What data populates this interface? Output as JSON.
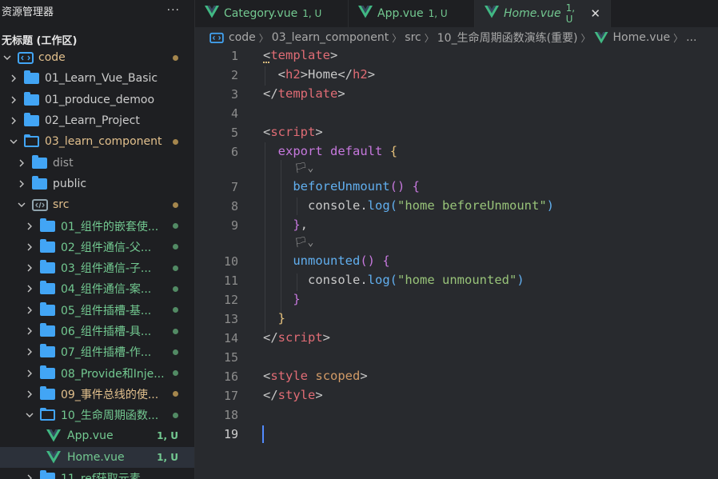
{
  "sidebar": {
    "title": "资源管理器",
    "more": "···",
    "workspace": "无标题 (工作区)",
    "items": [
      {
        "label": "code",
        "kind": "root",
        "badge": ""
      },
      {
        "label": "01_Learn_Vue_Basic",
        "kind": "folder"
      },
      {
        "label": "01_produce_demoo",
        "kind": "folder"
      },
      {
        "label": "02_Learn_Project",
        "kind": "folder"
      },
      {
        "label": "03_learn_component",
        "kind": "folder-open"
      },
      {
        "label": "dist",
        "kind": "folder"
      },
      {
        "label": "public",
        "kind": "folder"
      },
      {
        "label": "src",
        "kind": "src"
      },
      {
        "label": "01_组件的嵌套使...",
        "kind": "folder"
      },
      {
        "label": "02_组件通信-父...",
        "kind": "folder"
      },
      {
        "label": "03_组件通信-子...",
        "kind": "folder"
      },
      {
        "label": "04_组件通信-案...",
        "kind": "folder"
      },
      {
        "label": "05_组件插槽-基...",
        "kind": "folder"
      },
      {
        "label": "06_组件插槽-具...",
        "kind": "folder"
      },
      {
        "label": "07_组件插槽-作...",
        "kind": "folder"
      },
      {
        "label": "08_Provide和Inje...",
        "kind": "folder"
      },
      {
        "label": "09_事件总线的使...",
        "kind": "folder"
      },
      {
        "label": "10_生命周期函数...",
        "kind": "folder-open"
      },
      {
        "label": "App.vue",
        "kind": "vue",
        "badge": "1, U"
      },
      {
        "label": "Home.vue",
        "kind": "vue",
        "badge": "1, U"
      },
      {
        "label": "11_ref获取元素...",
        "kind": "folder"
      }
    ]
  },
  "tabs": [
    {
      "name": "Category.vue",
      "badge": "1, U",
      "active": false
    },
    {
      "name": "App.vue",
      "badge": "1, U",
      "active": false
    },
    {
      "name": "Home.vue",
      "badge": "1, U",
      "active": true
    }
  ],
  "tab_close": "✕",
  "breadcrumb": {
    "parts": [
      "code",
      "03_learn_component",
      "src",
      "10_生命周期函数演练(重要)",
      "Home.vue",
      "..."
    ]
  },
  "editor": {
    "line_numbers": [
      "1",
      "2",
      "3",
      "4",
      "5",
      "6",
      "7",
      "8",
      "9",
      "10",
      "11",
      "12",
      "13",
      "14",
      "15",
      "16",
      "17",
      "18",
      "19"
    ],
    "lens": [
      "🏳",
      "🏳"
    ],
    "lens_chevron": "⌄"
  },
  "colors": {
    "vue_green": "#41b883",
    "vue_dark": "#35495e",
    "folder_blue": "#42a5f5",
    "untracked": "#73c991",
    "modified": "#e2c08d"
  }
}
